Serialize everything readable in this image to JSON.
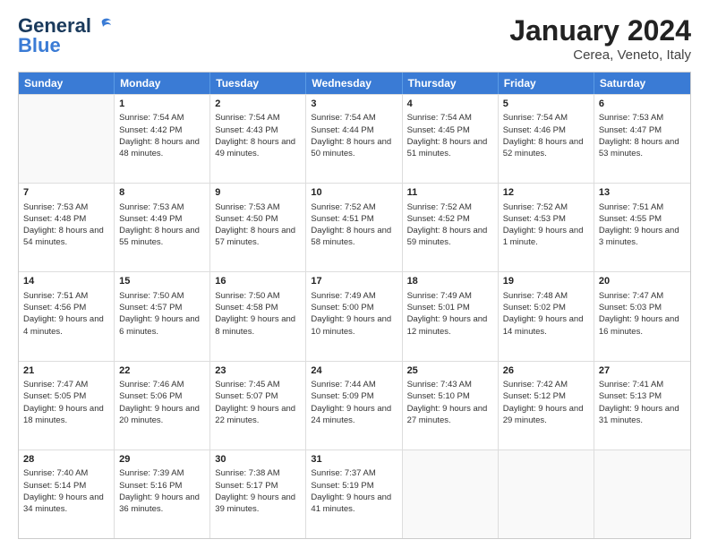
{
  "header": {
    "logo_line1": "General",
    "logo_line2": "Blue",
    "month": "January 2024",
    "location": "Cerea, Veneto, Italy"
  },
  "days_of_week": [
    "Sunday",
    "Monday",
    "Tuesday",
    "Wednesday",
    "Thursday",
    "Friday",
    "Saturday"
  ],
  "weeks": [
    [
      {
        "day": "",
        "sunrise": "",
        "sunset": "",
        "daylight": ""
      },
      {
        "day": "1",
        "sunrise": "Sunrise: 7:54 AM",
        "sunset": "Sunset: 4:42 PM",
        "daylight": "Daylight: 8 hours and 48 minutes."
      },
      {
        "day": "2",
        "sunrise": "Sunrise: 7:54 AM",
        "sunset": "Sunset: 4:43 PM",
        "daylight": "Daylight: 8 hours and 49 minutes."
      },
      {
        "day": "3",
        "sunrise": "Sunrise: 7:54 AM",
        "sunset": "Sunset: 4:44 PM",
        "daylight": "Daylight: 8 hours and 50 minutes."
      },
      {
        "day": "4",
        "sunrise": "Sunrise: 7:54 AM",
        "sunset": "Sunset: 4:45 PM",
        "daylight": "Daylight: 8 hours and 51 minutes."
      },
      {
        "day": "5",
        "sunrise": "Sunrise: 7:54 AM",
        "sunset": "Sunset: 4:46 PM",
        "daylight": "Daylight: 8 hours and 52 minutes."
      },
      {
        "day": "6",
        "sunrise": "Sunrise: 7:53 AM",
        "sunset": "Sunset: 4:47 PM",
        "daylight": "Daylight: 8 hours and 53 minutes."
      }
    ],
    [
      {
        "day": "7",
        "sunrise": "Sunrise: 7:53 AM",
        "sunset": "Sunset: 4:48 PM",
        "daylight": "Daylight: 8 hours and 54 minutes."
      },
      {
        "day": "8",
        "sunrise": "Sunrise: 7:53 AM",
        "sunset": "Sunset: 4:49 PM",
        "daylight": "Daylight: 8 hours and 55 minutes."
      },
      {
        "day": "9",
        "sunrise": "Sunrise: 7:53 AM",
        "sunset": "Sunset: 4:50 PM",
        "daylight": "Daylight: 8 hours and 57 minutes."
      },
      {
        "day": "10",
        "sunrise": "Sunrise: 7:52 AM",
        "sunset": "Sunset: 4:51 PM",
        "daylight": "Daylight: 8 hours and 58 minutes."
      },
      {
        "day": "11",
        "sunrise": "Sunrise: 7:52 AM",
        "sunset": "Sunset: 4:52 PM",
        "daylight": "Daylight: 8 hours and 59 minutes."
      },
      {
        "day": "12",
        "sunrise": "Sunrise: 7:52 AM",
        "sunset": "Sunset: 4:53 PM",
        "daylight": "Daylight: 9 hours and 1 minute."
      },
      {
        "day": "13",
        "sunrise": "Sunrise: 7:51 AM",
        "sunset": "Sunset: 4:55 PM",
        "daylight": "Daylight: 9 hours and 3 minutes."
      }
    ],
    [
      {
        "day": "14",
        "sunrise": "Sunrise: 7:51 AM",
        "sunset": "Sunset: 4:56 PM",
        "daylight": "Daylight: 9 hours and 4 minutes."
      },
      {
        "day": "15",
        "sunrise": "Sunrise: 7:50 AM",
        "sunset": "Sunset: 4:57 PM",
        "daylight": "Daylight: 9 hours and 6 minutes."
      },
      {
        "day": "16",
        "sunrise": "Sunrise: 7:50 AM",
        "sunset": "Sunset: 4:58 PM",
        "daylight": "Daylight: 9 hours and 8 minutes."
      },
      {
        "day": "17",
        "sunrise": "Sunrise: 7:49 AM",
        "sunset": "Sunset: 5:00 PM",
        "daylight": "Daylight: 9 hours and 10 minutes."
      },
      {
        "day": "18",
        "sunrise": "Sunrise: 7:49 AM",
        "sunset": "Sunset: 5:01 PM",
        "daylight": "Daylight: 9 hours and 12 minutes."
      },
      {
        "day": "19",
        "sunrise": "Sunrise: 7:48 AM",
        "sunset": "Sunset: 5:02 PM",
        "daylight": "Daylight: 9 hours and 14 minutes."
      },
      {
        "day": "20",
        "sunrise": "Sunrise: 7:47 AM",
        "sunset": "Sunset: 5:03 PM",
        "daylight": "Daylight: 9 hours and 16 minutes."
      }
    ],
    [
      {
        "day": "21",
        "sunrise": "Sunrise: 7:47 AM",
        "sunset": "Sunset: 5:05 PM",
        "daylight": "Daylight: 9 hours and 18 minutes."
      },
      {
        "day": "22",
        "sunrise": "Sunrise: 7:46 AM",
        "sunset": "Sunset: 5:06 PM",
        "daylight": "Daylight: 9 hours and 20 minutes."
      },
      {
        "day": "23",
        "sunrise": "Sunrise: 7:45 AM",
        "sunset": "Sunset: 5:07 PM",
        "daylight": "Daylight: 9 hours and 22 minutes."
      },
      {
        "day": "24",
        "sunrise": "Sunrise: 7:44 AM",
        "sunset": "Sunset: 5:09 PM",
        "daylight": "Daylight: 9 hours and 24 minutes."
      },
      {
        "day": "25",
        "sunrise": "Sunrise: 7:43 AM",
        "sunset": "Sunset: 5:10 PM",
        "daylight": "Daylight: 9 hours and 27 minutes."
      },
      {
        "day": "26",
        "sunrise": "Sunrise: 7:42 AM",
        "sunset": "Sunset: 5:12 PM",
        "daylight": "Daylight: 9 hours and 29 minutes."
      },
      {
        "day": "27",
        "sunrise": "Sunrise: 7:41 AM",
        "sunset": "Sunset: 5:13 PM",
        "daylight": "Daylight: 9 hours and 31 minutes."
      }
    ],
    [
      {
        "day": "28",
        "sunrise": "Sunrise: 7:40 AM",
        "sunset": "Sunset: 5:14 PM",
        "daylight": "Daylight: 9 hours and 34 minutes."
      },
      {
        "day": "29",
        "sunrise": "Sunrise: 7:39 AM",
        "sunset": "Sunset: 5:16 PM",
        "daylight": "Daylight: 9 hours and 36 minutes."
      },
      {
        "day": "30",
        "sunrise": "Sunrise: 7:38 AM",
        "sunset": "Sunset: 5:17 PM",
        "daylight": "Daylight: 9 hours and 39 minutes."
      },
      {
        "day": "31",
        "sunrise": "Sunrise: 7:37 AM",
        "sunset": "Sunset: 5:19 PM",
        "daylight": "Daylight: 9 hours and 41 minutes."
      },
      {
        "day": "",
        "sunrise": "",
        "sunset": "",
        "daylight": ""
      },
      {
        "day": "",
        "sunrise": "",
        "sunset": "",
        "daylight": ""
      },
      {
        "day": "",
        "sunrise": "",
        "sunset": "",
        "daylight": ""
      }
    ]
  ]
}
